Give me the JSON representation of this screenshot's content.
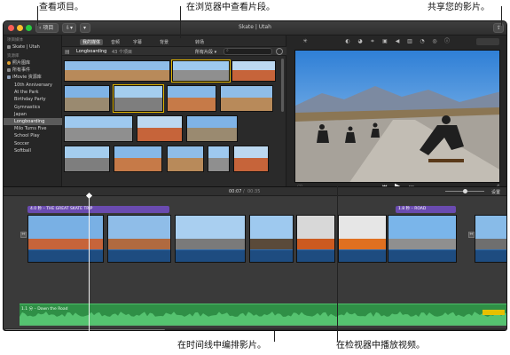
{
  "callouts": {
    "browse_items": "查看项目。",
    "view_in_browser": "在浏览器中查看片段。",
    "share_movie": "共享您的影片。",
    "arrange_in_timeline": "在时间线中编排影片。",
    "play_in_viewer": "在检视器中播放视频。"
  },
  "window": {
    "title": "Skate | Utah",
    "back_label": "项目",
    "traffic_colors": [
      "#fc5e57",
      "#fdbc2e",
      "#28c840"
    ]
  },
  "browser": {
    "tabs": [
      "我的媒体",
      "音频",
      "字幕",
      "背景",
      "转场"
    ],
    "selected_tab": 0,
    "event_title": "Longboarding",
    "event_count": "43 个项目",
    "filter_label": "所有片段"
  },
  "library": {
    "section_header": "项目媒体",
    "project_item": "Skate | Utah",
    "library_header": "资源库",
    "photos_item": "照片图库",
    "all_events_item": "所有事件",
    "imovie_library_item": "iMovie 资源库",
    "events": [
      "10th Anniversary",
      "At the Park",
      "Birthday Party",
      "Gymnastics",
      "Japan",
      "Longboarding",
      "Milo Turns Five",
      "School Play",
      "Soccer",
      "Softball"
    ],
    "selected_event_index": 5
  },
  "viewer": {
    "time_current": "00:07",
    "time_total": "00:35"
  },
  "timeline": {
    "settings_label": "设置",
    "title_clip_1": "4.0 秒 – THE GREAT SKATE TRIP",
    "title_clip_2": "1.8 秒 – ROAD",
    "music_label": "1.1 分 – Down the Road"
  },
  "colors": {
    "desert_sky": "#7fb3e6",
    "desert_rock": "#c6643a",
    "road": "#8f8f8f",
    "music_green": "#2f8f46",
    "audio_blue": "#1e4c80",
    "title_purple": "#6a4bb0"
  }
}
